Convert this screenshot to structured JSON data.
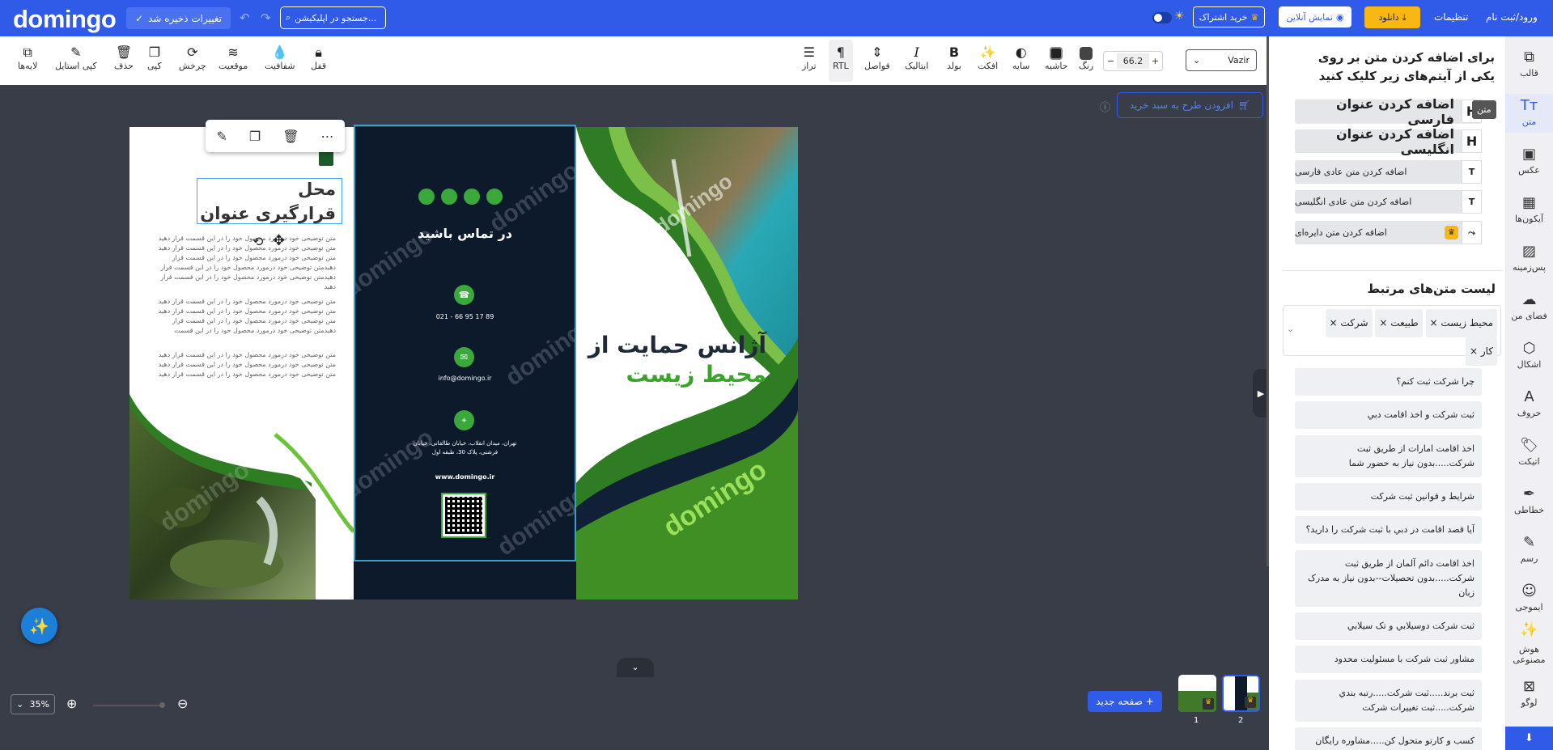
{
  "topbar": {
    "logo": "domingo",
    "saved_label": "تغییرات ذخیره شد",
    "search_placeholder": "جستجو در اپلیکیشن...",
    "buy_subscription": "خرید اشتراک",
    "online_show": "نمایش آنلاین",
    "download": "دانلود",
    "settings": "تنظیمات",
    "login": "ورود/ثبت نام"
  },
  "toolbar": {
    "layers": "لایه‌ها",
    "copy_style": "کپی استایل",
    "delete": "حذف",
    "copy": "کپی",
    "rotate": "چرخش",
    "position": "موقعیت",
    "opacity": "شفافیت",
    "lock": "قفل",
    "align": "تراز",
    "rtl": "RTL",
    "spacing": "فواصل",
    "italic": "ایتالیک",
    "bold": "بولد",
    "effect": "افکت",
    "shadow": "سایه",
    "border": "حاشیه",
    "color": "رنگ",
    "font_size": "66.2",
    "font_family": "Vazir"
  },
  "canvas": {
    "add_to_cart": "افزودن طرح به سبد خرید",
    "panel1": {
      "title_line1": "محل",
      "title_line2": "قرارگیری عنوان",
      "para1": "متن توضیحی خود درمورد محصول خود را در این قسمت قرار دهید متن توضیحی خود درمورد محصول خود را در این قسمت قرار دهید متن توضیحی خود درمورد محصول خود را در این قسمت قرار دهیدمتن توضیحی خود درمورد محصول خود را در این قسمت قرار دهیدمتن توضیحی خود درمورد محصول خود را در این قسمت قرار دهید",
      "para2": "متن توضیحی خود درمورد محصول خود را در این قسمت قرار دهید متن توضیحی خود درمورد محصول خود را در این قسمت قرار دهید متن توضیحی خود درمورد محصول خود را در این قسمت قرار دهیدمتن توضیحی خود درمورد محصول خود را در این قسمت",
      "para3": "متن توضیحی خود درمورد محصول خود را در این قسمت قرار دهید متن توضیحی خود درمورد محصول خود را در این قسمت قرار دهید متن توضیحی خود درمورد محصول خود را در این قسمت قرار دهید"
    },
    "panel2": {
      "heading": "در تماس باشید",
      "phone": "021 - 66 95 17 89",
      "email": "info@domingo.ir",
      "address_line1": "تهران، میدان انقلاب، خیابان طالقانی، خیابان",
      "address_line2": "فرشتی، پلاک 30، طبقه اول",
      "website": "www.domingo.ir"
    },
    "panel3": {
      "title_line1": "آژانس حمایت از",
      "title_line2": "محیط زیست",
      "brand": "domingo"
    },
    "watermark": "domingo"
  },
  "bottom": {
    "zoom": "35%",
    "new_page": "صفحه جدید",
    "page1_num": "1",
    "page2_num": "2"
  },
  "sidebar": {
    "instruction": "برای اضافه کردن متن بر روی یکی از آیتم‌های زیر کلیک کنید",
    "tooltip": "متن",
    "add_persian_title": "اضافه کردن عنوان فارسی",
    "add_english_title": "اضافه کردن عنوان انگلیسی",
    "add_persian_text": "اضافه کردن متن عادی فارسی",
    "add_english_text": "اضافه کردن متن عادی انگلیسی",
    "add_circle_text": "اضافه کردن متن دایره‌ای",
    "related_heading": "لیست متن‌های مرتبط",
    "tags": [
      "محیط زیست",
      "طبیعت",
      "شرکت",
      "کار"
    ],
    "related": [
      "چرا شرکت ثبت کنم؟",
      "ثبت شرکت و اخذ اقامت دبي",
      "اخذ اقامت امارات از طریق ثبت شرکت.....بدون نیاز به حضور شما",
      "شرایط و قوانین ثبت شرکت",
      "آیا قصد اقامت در دبي با ثبت شرکت را دارید؟",
      "اخذ اقامت دائم آلمان از طریق ثبت شرکت.....بدون تحصیلات--بدون نیاز به مدرک زبان",
      "ثبت شرکت دوسیلابي و تک سیلابي",
      "مشاور ثبت شرکت با مسئولیت محدود",
      "ثبت برند.....ثبت شرکت.....رتبه بندي شرکت.....ثبت تغییرات شرکت",
      "کسب و کارتو متحول کن.....مشاوره رایگان ثبت"
    ]
  },
  "iconbar": {
    "template": "قالب",
    "text": "متن",
    "photo": "عکس",
    "icons": "آیکون‌ها",
    "background": "پس‌زمینه",
    "my_space": "فضای من",
    "shapes": "اشکال",
    "letters": "حروف",
    "label": "اتیکت",
    "calligraphy": "خطاطی",
    "draw": "رسم",
    "emoji": "ایموجی",
    "ai_line1": "هوش",
    "ai_line2": "مصنوعی",
    "logo": "لوگو"
  }
}
